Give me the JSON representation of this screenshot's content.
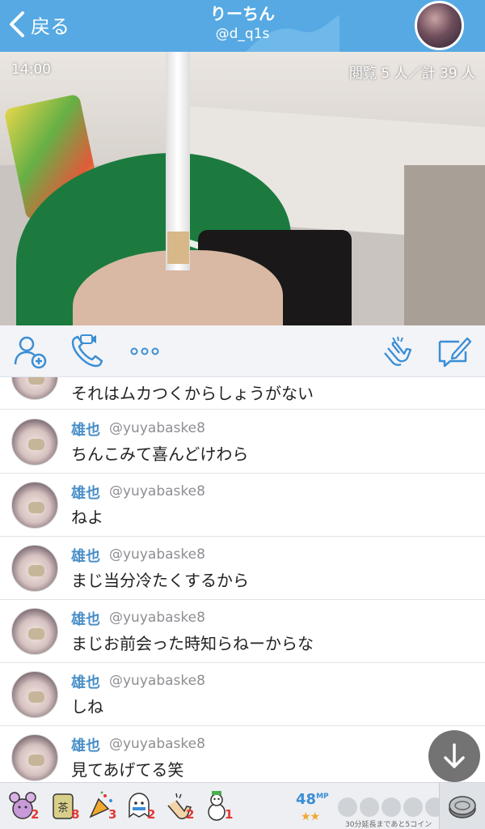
{
  "header": {
    "back_label": "戻る",
    "title": "りーちん",
    "handle": "@d_q1s"
  },
  "video": {
    "time": "14:00",
    "viewers": "閲覧 5 人／計 39 人"
  },
  "toolbar": {
    "icons": [
      "add-friend-icon",
      "video-call-icon",
      "more-icon",
      "clap-icon",
      "compose-icon"
    ]
  },
  "comments": {
    "partial_message": "それはムカつくからしょうがない",
    "items": [
      {
        "name": "雄也",
        "handle": "@yuyabaske8",
        "message": "ちんこみて喜んどけわら"
      },
      {
        "name": "雄也",
        "handle": "@yuyabaske8",
        "message": "ねよ"
      },
      {
        "name": "雄也",
        "handle": "@yuyabaske8",
        "message": "まじ当分冷たくするから"
      },
      {
        "name": "雄也",
        "handle": "@yuyabaske8",
        "message": "まじお前会った時知らねーからな"
      },
      {
        "name": "雄也",
        "handle": "@yuyabaske8",
        "message": "しね"
      },
      {
        "name": "雄也",
        "handle": "@yuyabaske8",
        "message": "見てあげてる笑"
      }
    ]
  },
  "gifts": [
    {
      "icon": "mouse-gift-icon",
      "count": "2"
    },
    {
      "icon": "tea-gift-icon",
      "count": "8",
      "label": "茶"
    },
    {
      "icon": "party-popper-gift-icon",
      "count": "3"
    },
    {
      "icon": "ghost-gift-icon",
      "count": "2"
    },
    {
      "icon": "clap-gift-icon",
      "count": "2"
    },
    {
      "icon": "snowman-gift-icon",
      "count": "1"
    }
  ],
  "bottom": {
    "mp_value": "48",
    "mp_unit": "MP",
    "stars": "★★",
    "extension_text": "30分延長まであと5コイン"
  },
  "colors": {
    "header": "#56a9e3",
    "accent_blue": "#3a8ed6",
    "username": "#4a8fc8",
    "gift_count": "#e53935"
  }
}
